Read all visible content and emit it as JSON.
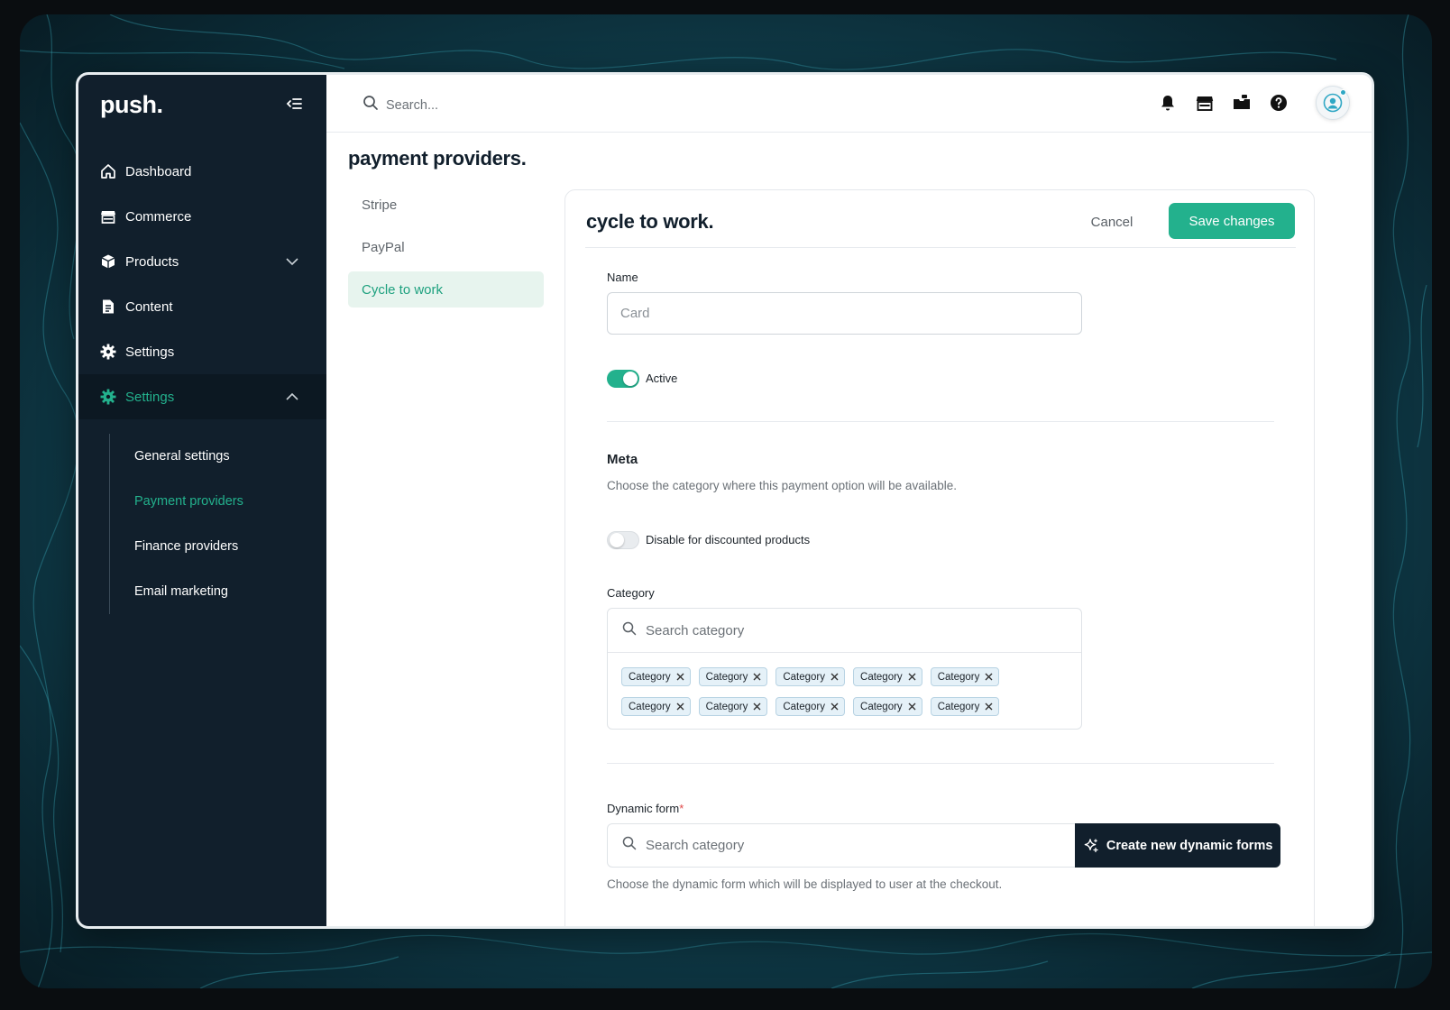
{
  "app": {
    "logo": "push."
  },
  "sidebar": {
    "items": [
      {
        "label": "Dashboard",
        "icon": "home-icon"
      },
      {
        "label": "Commerce",
        "icon": "store-icon"
      },
      {
        "label": "Products",
        "icon": "box-icon"
      },
      {
        "label": "Content",
        "icon": "document-icon"
      },
      {
        "label": "Settings",
        "icon": "gear-icon"
      },
      {
        "label": "Settings",
        "icon": "gear-icon"
      }
    ],
    "subitems": [
      {
        "label": "General settings"
      },
      {
        "label": "Payment providers"
      },
      {
        "label": "Finance providers"
      },
      {
        "label": "Email marketing"
      }
    ],
    "accent": "#23b18d",
    "background": "#111f2c"
  },
  "topbar": {
    "search_placeholder": "Search...",
    "icons": [
      "bell-icon",
      "store-icon",
      "inbox-icon",
      "help-icon",
      "user-avatar-icon"
    ]
  },
  "page": {
    "title": "payment providers.",
    "providers": [
      {
        "label": "Stripe"
      },
      {
        "label": "PayPal"
      },
      {
        "label": "Cycle to work"
      }
    ]
  },
  "card": {
    "title": "cycle to work.",
    "cancel_label": "Cancel",
    "save_label": "Save changes",
    "name_label": "Name",
    "name_placeholder": "Card",
    "active_label": "Active",
    "active_on": true,
    "meta_title": "Meta",
    "meta_help": "Choose the category where this payment option will be available.",
    "discount_label": "Disable for discounted products",
    "discount_on": false,
    "category_label": "Category",
    "category_placeholder": "Search category",
    "categories": [
      "Category",
      "Category",
      "Category",
      "Category",
      "Category",
      "Category",
      "Category",
      "Category",
      "Category",
      "Category"
    ],
    "dynamic_form_label": "Dynamic form",
    "dynamic_form_required": "*",
    "dynamic_form_placeholder": "Search category",
    "dynamic_form_button": "Create new dynamic forms",
    "dynamic_form_help": "Choose the dynamic form which will be displayed to user at the checkout."
  }
}
